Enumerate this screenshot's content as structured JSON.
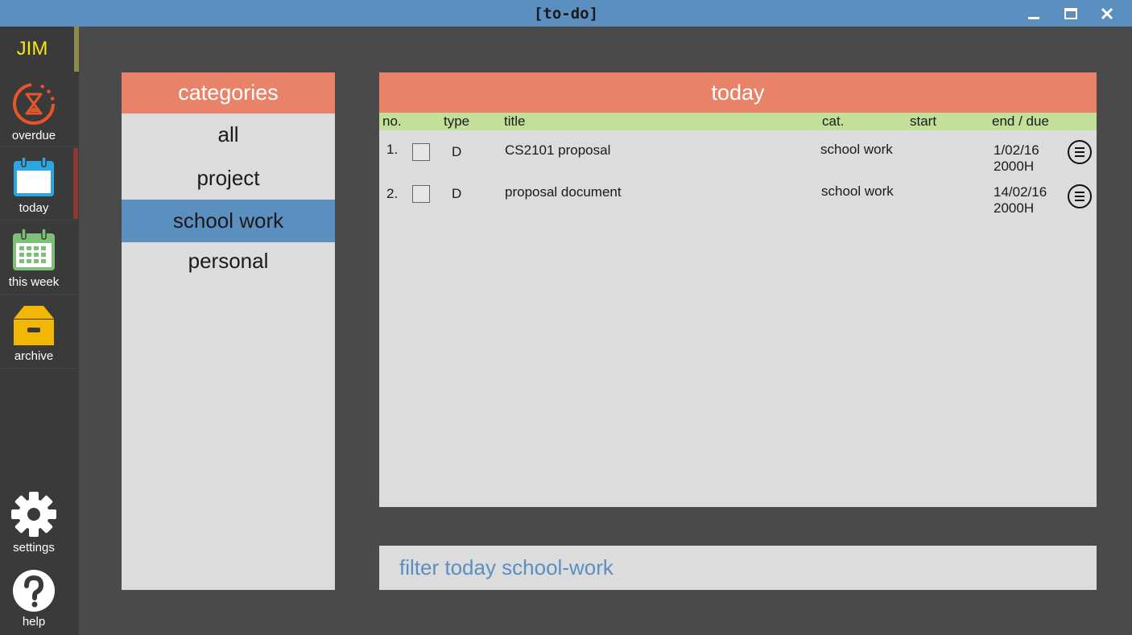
{
  "window": {
    "title": "[to-do]",
    "controls": {
      "minimize_icon": "minimize-icon",
      "maximize_icon": "maximize-icon",
      "close_icon": "close-icon"
    }
  },
  "sidebar": {
    "user": "JIM",
    "items": [
      {
        "label": "overdue",
        "icon": "hourglass-icon",
        "color": "#e8552a"
      },
      {
        "label": "today",
        "icon": "calendar-icon",
        "color": "#2aa7e0",
        "active": true
      },
      {
        "label": "this week",
        "icon": "calendar-week-icon",
        "color": "#7ec07a"
      },
      {
        "label": "archive",
        "icon": "archive-box-icon",
        "color": "#f2b705"
      }
    ],
    "bottom_items": [
      {
        "label": "settings",
        "icon": "gear-icon"
      },
      {
        "label": "help",
        "icon": "help-icon"
      }
    ]
  },
  "categories": {
    "header": "categories",
    "items": [
      "all",
      "project",
      "school work",
      "personal"
    ],
    "selected": "school work"
  },
  "tasks": {
    "header": "today",
    "columns": {
      "no": "no.",
      "type": "type",
      "title": "title",
      "cat": "cat.",
      "start": "start",
      "end": "end / due"
    },
    "rows": [
      {
        "no": "1.",
        "type": "D",
        "title": "CS2101 proposal",
        "cat": "school work",
        "start": "",
        "end_date": "1/02/16",
        "end_time": "2000H",
        "checked": false
      },
      {
        "no": "2.",
        "type": "D",
        "title": "proposal document",
        "cat": "school work",
        "start": "",
        "end_date": "14/02/16",
        "end_time": "2000H",
        "checked": false
      }
    ]
  },
  "command": {
    "value": "filter today school-work"
  },
  "colors": {
    "titlebar": "#5b8fc0",
    "panel_header": "#e8836a",
    "column_header": "#c3e09a",
    "selected": "#5b8fc0",
    "username": "#f5e614"
  }
}
